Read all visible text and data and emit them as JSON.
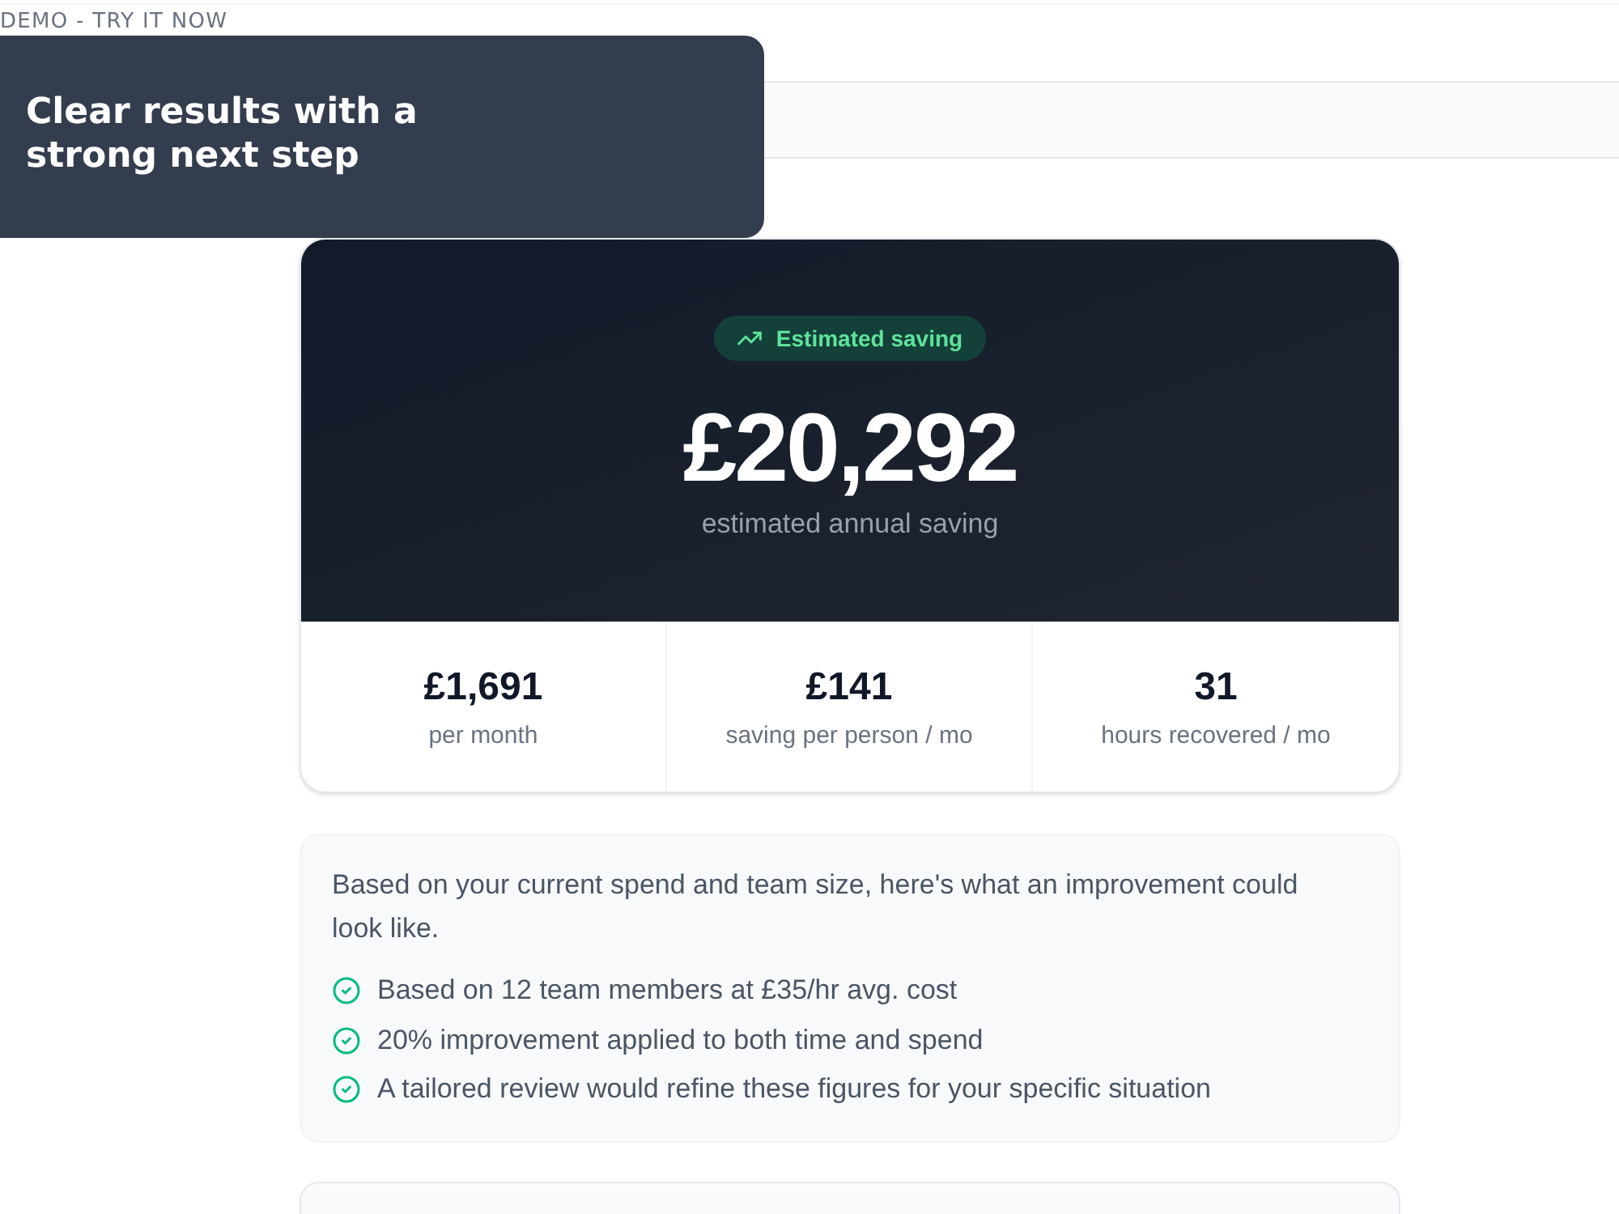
{
  "header": {
    "label": "DEMO - TRY IT NOW"
  },
  "callout": {
    "title": "Clear results with a strong next step"
  },
  "result": {
    "badge": "Estimated saving",
    "amount": "£20,292",
    "caption": "estimated annual saving",
    "stats": [
      {
        "value": "£1,691",
        "label": "per month"
      },
      {
        "value": "£141",
        "label": "saving per person / mo"
      },
      {
        "value": "31",
        "label": "hours recovered / mo"
      }
    ]
  },
  "summary": {
    "intro": "Based on your current spend and team size, here's what an improvement could look like.",
    "points": [
      "Based on 12 team members at £35/hr avg. cost",
      "20% improvement applied to both time and spend",
      "A tailored review would refine these figures for your specific situation"
    ]
  }
}
